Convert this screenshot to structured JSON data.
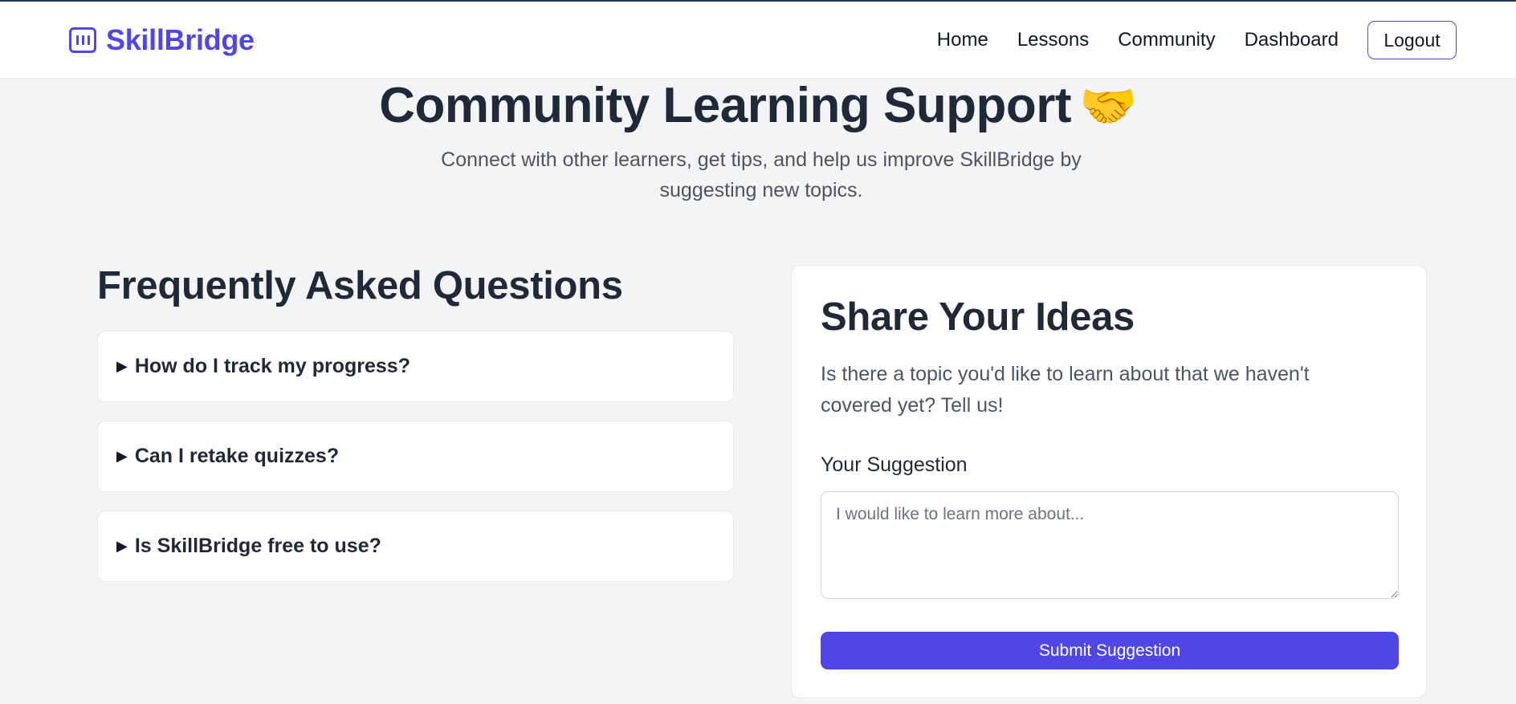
{
  "brand": {
    "name": "SkillBridge",
    "icon": "skillbridge-logo-icon",
    "accent_color": "#4f46e5"
  },
  "nav": {
    "items": [
      {
        "label": "Home"
      },
      {
        "label": "Lessons"
      },
      {
        "label": "Community"
      },
      {
        "label": "Dashboard"
      }
    ],
    "logout_label": "Logout"
  },
  "hero": {
    "title": "Community Learning Support",
    "emoji": "🤝",
    "subtitle": "Connect with other learners, get tips, and help us improve SkillBridge by suggesting new topics."
  },
  "faq": {
    "title": "Frequently Asked Questions",
    "expand_icon": "▶",
    "items": [
      {
        "question": "How do I track my progress?"
      },
      {
        "question": "Can I retake quizzes?"
      },
      {
        "question": "Is SkillBridge free to use?"
      }
    ]
  },
  "ideas": {
    "title": "Share Your Ideas",
    "description": "Is there a topic you'd like to learn about that we haven't covered yet? Tell us!",
    "field_label": "Your Suggestion",
    "placeholder": "I would like to learn more about...",
    "value": "",
    "submit_label": "Submit Suggestion"
  }
}
